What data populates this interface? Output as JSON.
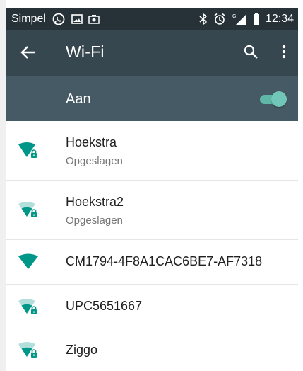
{
  "status_bar": {
    "carrier": "Simpel",
    "time": "12:34",
    "left_icons": [
      "whatsapp-icon",
      "image-icon",
      "photo-icon"
    ],
    "right_icons": [
      "bluetooth-icon",
      "alarm-icon",
      "signal-icon",
      "battery-icon"
    ]
  },
  "toolbar": {
    "title": "Wi-Fi",
    "back_icon": "arrow-back-icon",
    "search_icon": "search-icon",
    "more_icon": "more-vert-icon"
  },
  "wifi_toggle": {
    "label": "Aan",
    "state": "on"
  },
  "networks": [
    {
      "name": "Hoekstra",
      "status": "Opgeslagen",
      "secured": true,
      "signal": "full"
    },
    {
      "name": "Hoekstra2",
      "status": "Opgeslagen",
      "secured": true,
      "signal": "medium"
    },
    {
      "name": "CM1794-4F8A1CAC6BE7-AF7318",
      "status": "",
      "secured": false,
      "signal": "full"
    },
    {
      "name": "UPC5651667",
      "status": "",
      "secured": true,
      "signal": "medium"
    },
    {
      "name": "Ziggo",
      "status": "",
      "secured": true,
      "signal": "medium"
    }
  ],
  "colors": {
    "status_bar": "#263238",
    "toolbar": "#37474f",
    "toggle_row": "#455a64",
    "accent": "#009688",
    "accent_light": "#80cbc4",
    "text_primary": "#212121",
    "text_secondary": "#757575"
  }
}
